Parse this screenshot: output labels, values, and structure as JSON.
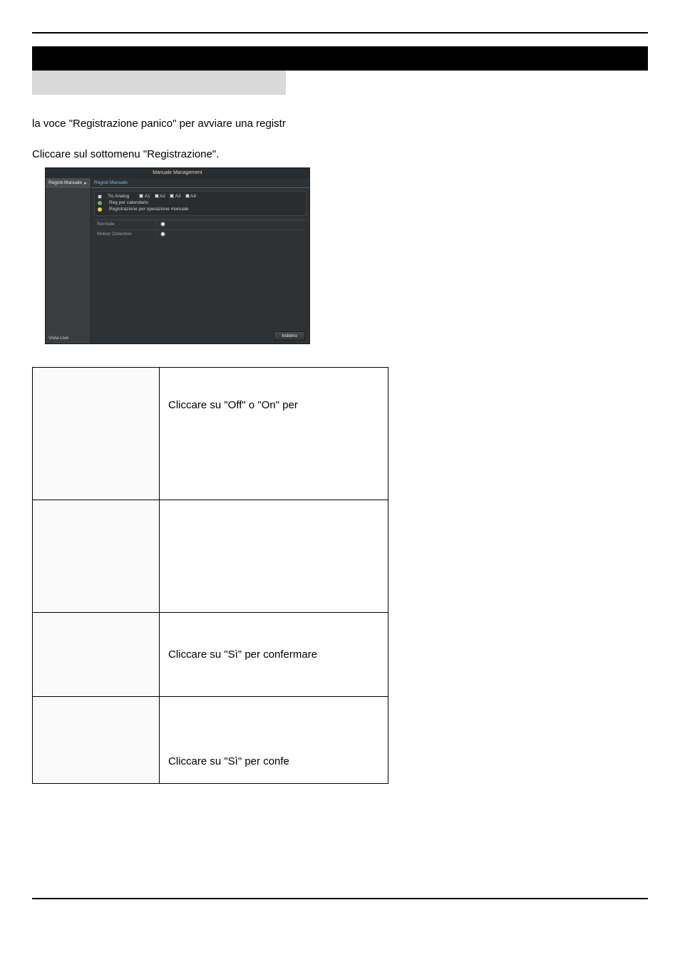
{
  "doc": {
    "line1": "la voce \"Registrazione panico\" per avviare una registr",
    "line2": "Cliccare sul sottomenu \"Registrazione\"."
  },
  "app": {
    "title": "Manuale Management",
    "sidebar": {
      "top_item": "Registr.Manuale",
      "chevron": "▸",
      "bottom_item": "Vista Live"
    },
    "tab_label": "Registr.Manuale",
    "panel": {
      "row_label": "Tlc Analog",
      "channels": {
        "a1": "A1",
        "a2": "A2",
        "a3": "A3",
        "a4": "A4"
      },
      "line2": "Reg per calendario",
      "line3": "Registrazione per operazione manuale"
    },
    "grid": {
      "rows": [
        {
          "label": "Normale"
        },
        {
          "label": "Motion Detection"
        }
      ]
    },
    "back_btn": "Indietro"
  },
  "table": {
    "rows": [
      {
        "right": "Cliccare su \"Off\" o \"On\" per"
      },
      {
        "right": ""
      },
      {
        "right": "Cliccare su \"Sì\" per confermare"
      },
      {
        "right": "Cliccare su \"Sì\" per confe"
      }
    ]
  }
}
